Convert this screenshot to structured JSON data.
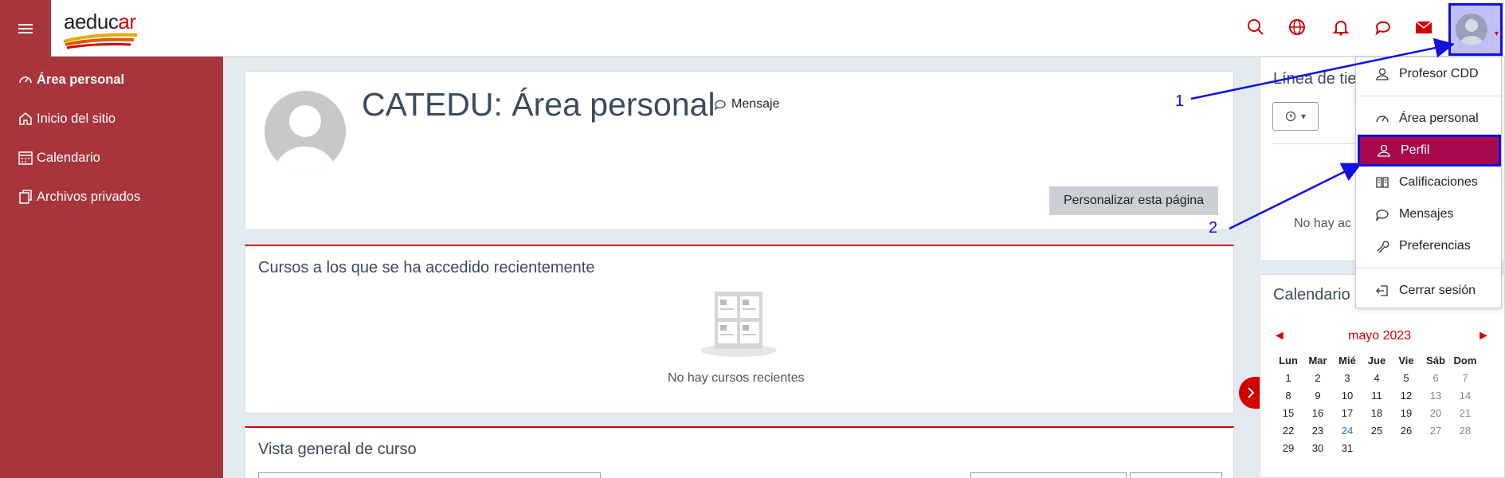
{
  "header": {
    "logo": "aeducar",
    "logo_main": "aeduc",
    "logo_accent": "ar",
    "icons": [
      "search-icon",
      "globe-icon",
      "bell-icon",
      "chat-icon",
      "mail-icon"
    ]
  },
  "sidebar": {
    "items": [
      {
        "label": "Área personal",
        "icon": "dashboard-icon",
        "active": true
      },
      {
        "label": "Inicio del sitio",
        "icon": "home-icon",
        "active": false
      },
      {
        "label": "Calendario",
        "icon": "calendar-icon",
        "active": false
      },
      {
        "label": "Archivos privados",
        "icon": "files-icon",
        "active": false
      }
    ]
  },
  "main": {
    "title": "CATEDU: Área personal",
    "message_link": "Mensaje",
    "customize_button": "Personalizar esta página",
    "recent_courses": {
      "title": "Cursos a los que se ha accedido recientemente",
      "empty": "No hay cursos recientes"
    },
    "overview": {
      "title": "Vista general de curso"
    }
  },
  "right": {
    "timeline": {
      "title": "Línea de tie",
      "empty": "No hay ac"
    },
    "calendar": {
      "title": "Calendario",
      "month": "mayo 2023",
      "prev": "◄",
      "next": "►",
      "weekdays": [
        "Lun",
        "Mar",
        "Mié",
        "Jue",
        "Vie",
        "Sáb",
        "Dom"
      ],
      "weeks": [
        [
          "1",
          "2",
          "3",
          "4",
          "5",
          "6",
          "7"
        ],
        [
          "8",
          "9",
          "10",
          "11",
          "12",
          "13",
          "14"
        ],
        [
          "15",
          "16",
          "17",
          "18",
          "19",
          "20",
          "21"
        ],
        [
          "22",
          "23",
          "24",
          "25",
          "26",
          "27",
          "28"
        ],
        [
          "29",
          "30",
          "31",
          "",
          "",
          "",
          ""
        ]
      ],
      "today": "24"
    }
  },
  "user_menu": {
    "items": [
      {
        "label": "Profesor CDD",
        "icon": "user-icon"
      },
      {
        "label": "Área personal",
        "icon": "dashboard-icon"
      },
      {
        "label": "Perfil",
        "icon": "user-icon"
      },
      {
        "label": "Calificaciones",
        "icon": "book-icon"
      },
      {
        "label": "Mensajes",
        "icon": "chat-icon"
      },
      {
        "label": "Preferencias",
        "icon": "wrench-icon"
      },
      {
        "label": "Cerrar sesión",
        "icon": "logout-icon"
      }
    ],
    "selected": "Perfil"
  },
  "annotations": {
    "step1": "1",
    "step2": "2"
  },
  "colors": {
    "brand": "#a8353b",
    "accent": "#d40000",
    "selected": "#a8094c",
    "annotation": "#1010e0"
  }
}
